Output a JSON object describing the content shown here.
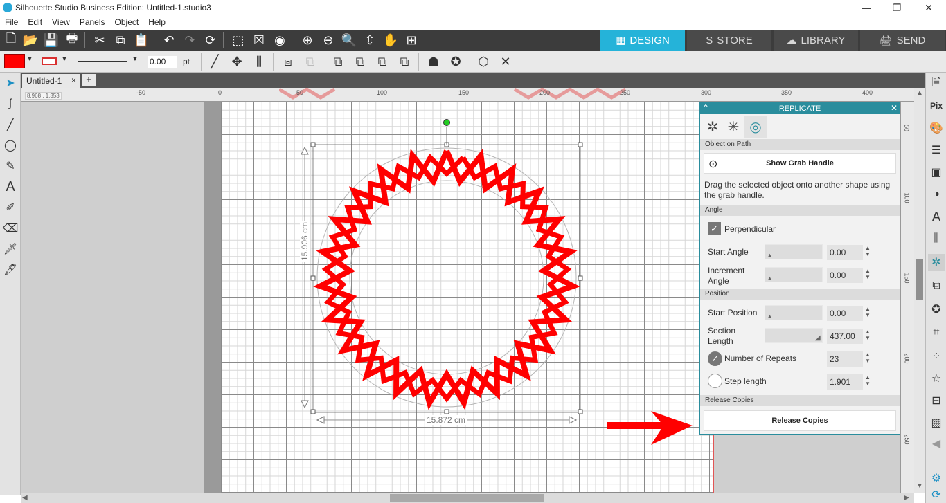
{
  "window": {
    "title": "Silhouette Studio Business Edition: Untitled-1.studio3"
  },
  "menu": [
    "File",
    "Edit",
    "View",
    "Panels",
    "Object",
    "Help"
  ],
  "nav_tabs": [
    {
      "label": "DESIGN",
      "icon": "grid-icon"
    },
    {
      "label": "STORE",
      "icon": "silhouette-s-icon"
    },
    {
      "label": "LIBRARY",
      "icon": "cloud-icon"
    },
    {
      "label": "SEND",
      "icon": "cutter-icon"
    }
  ],
  "line_width": {
    "value": "0.00",
    "unit": "pt"
  },
  "colors": {
    "fill": "#ff0000",
    "line": "#d93030",
    "accent": "#2a8d9d",
    "nav_active": "#25b3d9"
  },
  "doc_tab": {
    "label": "Untitled-1",
    "close": "×",
    "add": "+"
  },
  "cursor_coords": "8.968 , 1.353",
  "hruler_labels": [
    "-50",
    "0",
    "50",
    "100",
    "150",
    "200",
    "250",
    "300",
    "350",
    "400"
  ],
  "vruler_labels": [
    "50",
    "100",
    "150",
    "200",
    "250"
  ],
  "dims": {
    "height": "15.906 cm",
    "width": "15.872 cm"
  },
  "panel": {
    "title": "REPLICATE",
    "section_object_on_path": "Object on Path",
    "show_grab_handle": "Show Grab Handle",
    "instructions": "Drag the selected object onto another shape using the grab handle.",
    "section_angle": "Angle",
    "perpendicular": "Perpendicular",
    "start_angle_label": "Start Angle",
    "start_angle": "0.00",
    "increment_angle_label": "Increment Angle",
    "increment_angle": "0.00",
    "section_position": "Position",
    "start_position_label": "Start Position",
    "start_position": "0.00",
    "section_length_label": "Section Length",
    "section_length": "437.00",
    "number_of_repeats_label": "Number of Repeats",
    "number_of_repeats": "23",
    "step_length_label": "Step length",
    "step_length": "1.901",
    "section_release": "Release Copies",
    "release_copies": "Release Copies"
  }
}
